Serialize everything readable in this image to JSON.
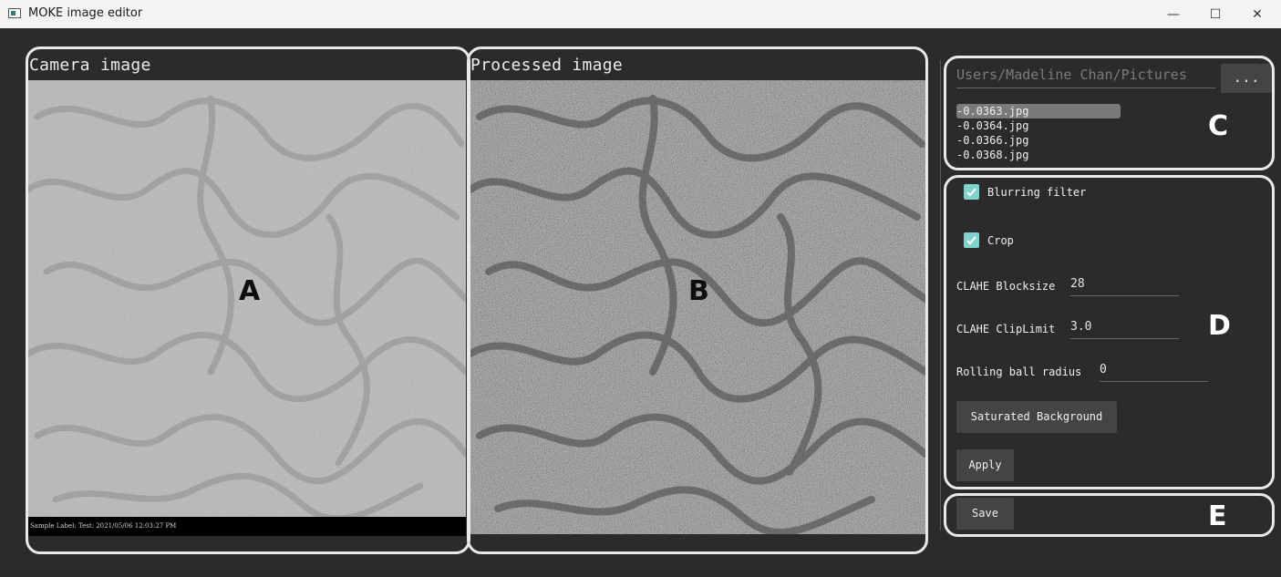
{
  "window": {
    "title": "MOKE image editor",
    "minimize_glyph": "—",
    "maximize_glyph": "☐",
    "close_glyph": "✕"
  },
  "camera_panel": {
    "title": "Camera image",
    "footer_text": "Sample Label: Test:  2021/05/06 12:03:27 PM",
    "marker": "A"
  },
  "processed_panel": {
    "title": "Processed image",
    "marker": "B"
  },
  "file_browser": {
    "path": "Users/Madeline Chan/Pictures",
    "browse_label": "...",
    "files": [
      "-0.0363.jpg",
      "-0.0364.jpg",
      "-0.0366.jpg",
      "-0.0368.jpg"
    ],
    "selected_index": 0,
    "marker": "C"
  },
  "settings": {
    "blurring_label": "Blurring filter",
    "blurring_checked": true,
    "crop_label": "Crop",
    "crop_checked": true,
    "clahe_blocksize_label": "CLAHE Blocksize",
    "clahe_blocksize_value": "28",
    "clahe_cliplimit_label": "CLAHE ClipLimit",
    "clahe_cliplimit_value": "3.0",
    "rolling_ball_label": "Rolling ball radius",
    "rolling_ball_value": "0",
    "saturated_bg_label": "Saturated Background",
    "apply_label": "Apply",
    "marker": "D"
  },
  "save_section": {
    "save_label": "Save",
    "marker": "E"
  },
  "colors": {
    "background": "#2b2b2b",
    "checkbox": "#7fd3cc",
    "button": "#444444",
    "annotation": "#e9e9e9"
  }
}
